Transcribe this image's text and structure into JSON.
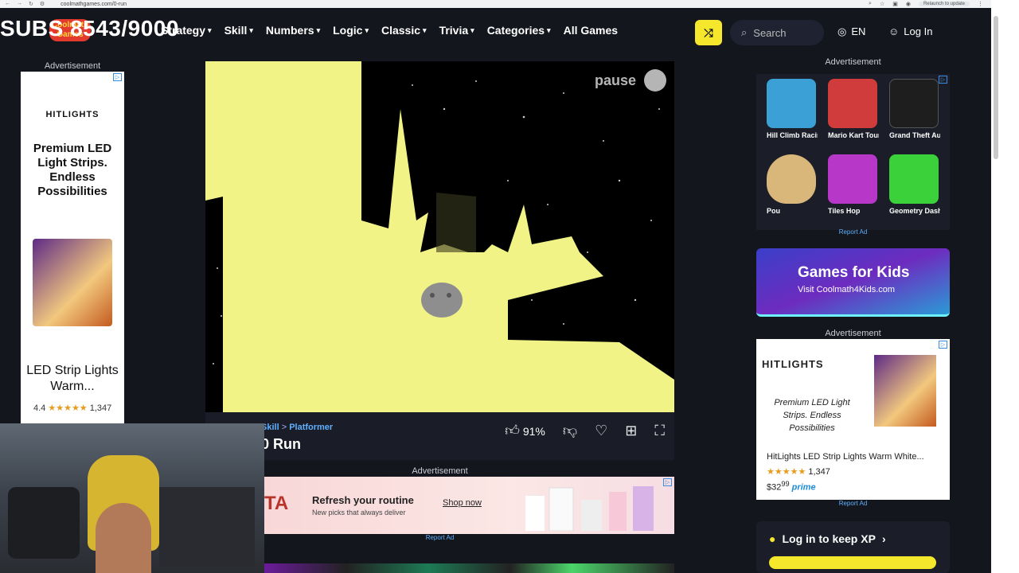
{
  "browser": {
    "url": "coolmathgames.com/0-run",
    "relaunch": "Relaunch to update"
  },
  "overlay": {
    "subs": "SUBS 8543/9000"
  },
  "nav": {
    "logo": "Coolmath Games",
    "items": [
      "Strategy",
      "Skill",
      "Numbers",
      "Logic",
      "Classic",
      "Trivia",
      "Categories",
      "All Games"
    ],
    "search_placeholder": "Search",
    "lang": "EN",
    "login": "Log In"
  },
  "left_ad": {
    "label": "Advertisement",
    "brand": "HITLIGHTS",
    "headline": "Premium LED Light Strips. Endless Possibilities",
    "product": "LED Strip Lights Warm...",
    "rating": "4.4",
    "stars": "★★★★★",
    "reviews": "1,347"
  },
  "game": {
    "pause": "pause",
    "crumb_parent": "Skill",
    "crumb_sep": ">",
    "crumb_child": "Platformer",
    "title": "0 Run",
    "like_pct": "91%"
  },
  "mid_ad": {
    "label": "Advertisement",
    "brand": "TA",
    "headline": "Refresh your routine",
    "sub": "New picks that always deliver",
    "cta": "Shop now",
    "report": "Report Ad"
  },
  "right": {
    "label": "Advertisement",
    "games": [
      {
        "name": "Hill Climb Racing",
        "color": "#3aa0d6"
      },
      {
        "name": "Mario Kart Tour",
        "color": "#d03b3b"
      },
      {
        "name": "Grand Theft Auto",
        "color": "#1e1e1e"
      },
      {
        "name": "Pou",
        "color": "#d9b77a"
      },
      {
        "name": "Tiles Hop",
        "color": "#b637c8"
      },
      {
        "name": "Geometry Dash",
        "color": "#3bd13b"
      }
    ],
    "report1": "Report Ad",
    "kids_title": "Games for Kids",
    "kids_sub": "Visit Coolmath4Kids.com",
    "label2": "Advertisement",
    "ad2_brand": "HITLIGHTS",
    "ad2_tag": "Premium LED Light Strips. Endless Possibilities",
    "ad2_product": "HitLights LED Strip Lights Warm White...",
    "ad2_stars": "★★★★★",
    "ad2_reviews": "1,347",
    "ad2_price": "$32",
    "ad2_cents": "99",
    "ad2_prime": "prime",
    "report2": "Report Ad",
    "xp": "Log in to keep XP"
  }
}
